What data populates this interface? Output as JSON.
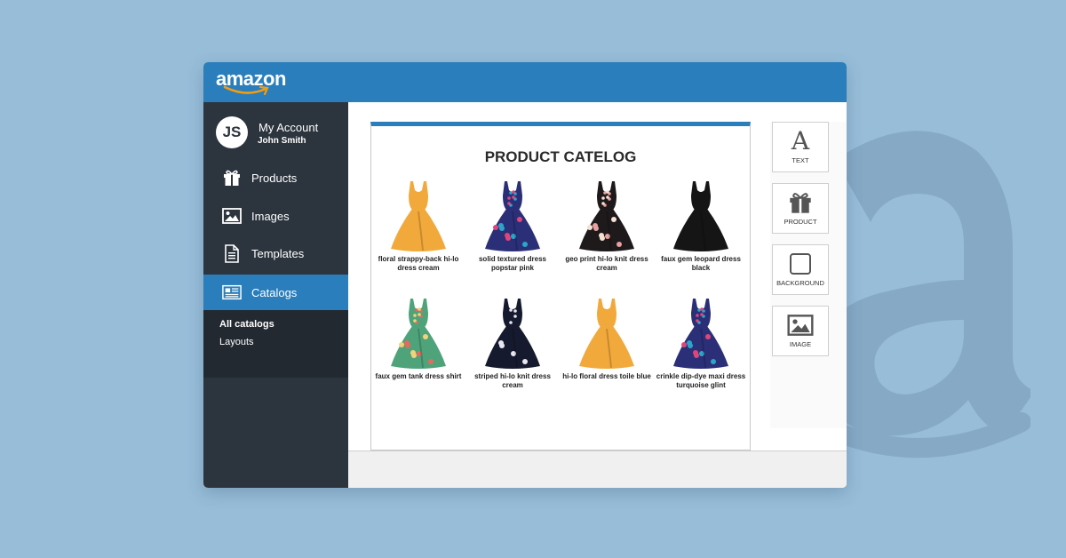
{
  "brand": {
    "logo_text": "amazon"
  },
  "account": {
    "initials": "JS",
    "title": "My Account",
    "name": "John Smith"
  },
  "nav": [
    {
      "label": "Products",
      "icon": "gift-icon"
    },
    {
      "label": "Images",
      "icon": "image-icon"
    },
    {
      "label": "Templates",
      "icon": "document-icon"
    },
    {
      "label": "Catalogs",
      "icon": "catalog-icon",
      "active": true
    }
  ],
  "submenu": [
    {
      "label": "All catalogs",
      "active": true
    },
    {
      "label": "Layouts"
    }
  ],
  "catalog": {
    "title": "PRODUCT CATELOG",
    "products": [
      {
        "name": "floral strappy-back hi-lo dress cream",
        "colors": [
          "#f2a93b"
        ]
      },
      {
        "name": "solid textured dress popstar pink",
        "colors": [
          "#2b2f78",
          "#2ba6c9",
          "#e0457a"
        ]
      },
      {
        "name": "geo print hi-lo knit dress cream",
        "colors": [
          "#1e1a1c",
          "#e8a0a0",
          "#f4e1d0"
        ]
      },
      {
        "name": "faux gem leopard dress black",
        "colors": [
          "#151515"
        ]
      },
      {
        "name": "faux gem tank dress shirt",
        "colors": [
          "#4fa37a",
          "#e46a5e",
          "#f2d37a"
        ]
      },
      {
        "name": "striped hi-lo knit dress cream",
        "colors": [
          "#161a2e",
          "#e8e8f0"
        ]
      },
      {
        "name": "hi-lo floral dress toile blue",
        "colors": [
          "#f2a93b"
        ]
      },
      {
        "name": "crinkle dip-dye maxi dress turquoise glint",
        "colors": [
          "#2b2f78",
          "#2ba6c9",
          "#e0457a"
        ]
      }
    ]
  },
  "tools": [
    {
      "label": "TEXT",
      "icon": "text-icon"
    },
    {
      "label": "PRODUCT",
      "icon": "gift-icon"
    },
    {
      "label": "BACKGROUND",
      "icon": "square-icon"
    },
    {
      "label": "IMAGE",
      "icon": "image-icon"
    }
  ],
  "colors": {
    "accent": "#2a7ebb",
    "sidebar": "#2c343e",
    "submenu": "#222931",
    "page_background": "#97bdd9"
  }
}
